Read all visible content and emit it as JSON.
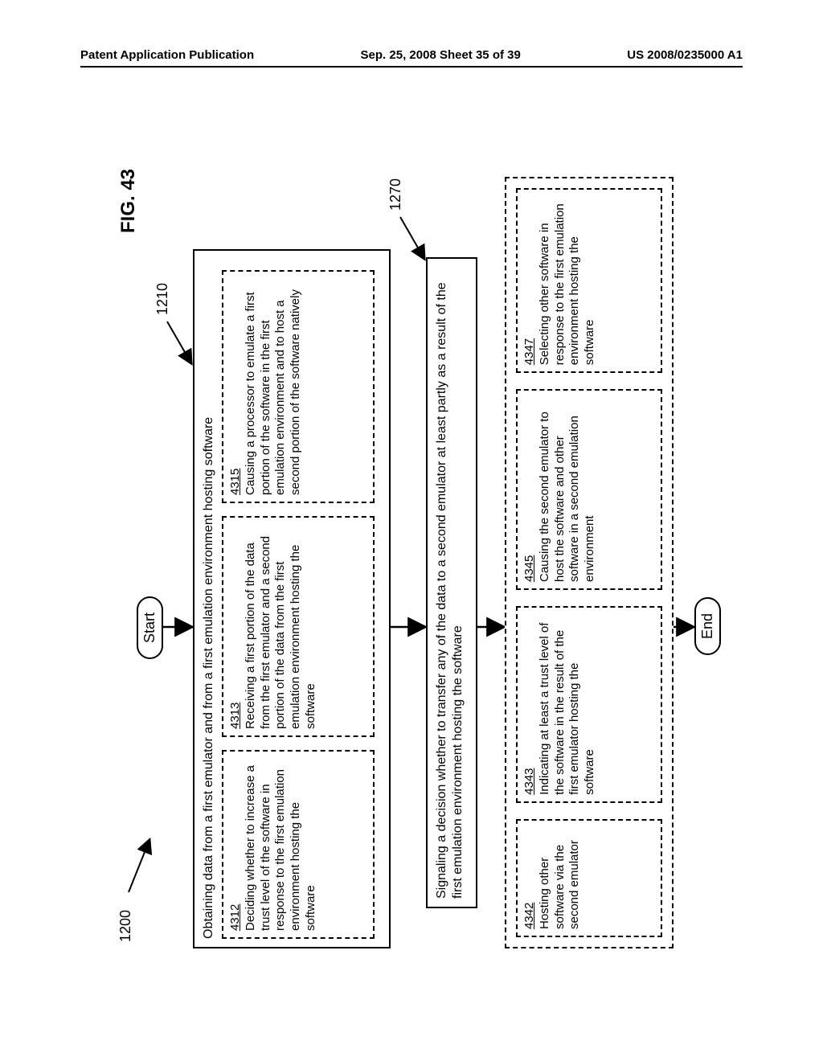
{
  "header": {
    "left": "Patent Application Publication",
    "center": "Sep. 25, 2008  Sheet 35 of 39",
    "right": "US 2008/0235000 A1"
  },
  "figure_label": "FIG. 43",
  "ref_1200": "1200",
  "ref_1210": "1210",
  "ref_1270": "1270",
  "start": "Start",
  "end": "End",
  "box_1210": {
    "title": "Obtaining data from a first emulator and from a first emulation environment hosting software",
    "b4312": {
      "num": "4312",
      "text": "Deciding whether to increase a trust level of the software in response to the first emulation environment hosting the software"
    },
    "b4313": {
      "num": "4313",
      "text": "Receiving a first portion of the data from the first emulator and a second portion of the data from the first emulation environment hosting the software"
    },
    "b4315": {
      "num": "4315",
      "text": "Causing a processor to emulate a first portion of the software in the first emulation environment and to host a second portion of the software natively"
    }
  },
  "box_1270": {
    "title": "Signaling a decision whether to transfer any of the data to a second emulator at least partly as a result of the first emulation environment hosting the software",
    "b4342": {
      "num": "4342",
      "text": "Hosting other software via the second emulator"
    },
    "b4343": {
      "num": "4343",
      "text": "Indicating at least a trust level of the software in the result of the first emulator hosting the software"
    },
    "b4345": {
      "num": "4345",
      "text": "Causing the second emulator to host the software and other software in a second emulation environment"
    },
    "b4347": {
      "num": "4347",
      "text": "Selecting other software in response to the first emulation environment hosting the software"
    }
  }
}
